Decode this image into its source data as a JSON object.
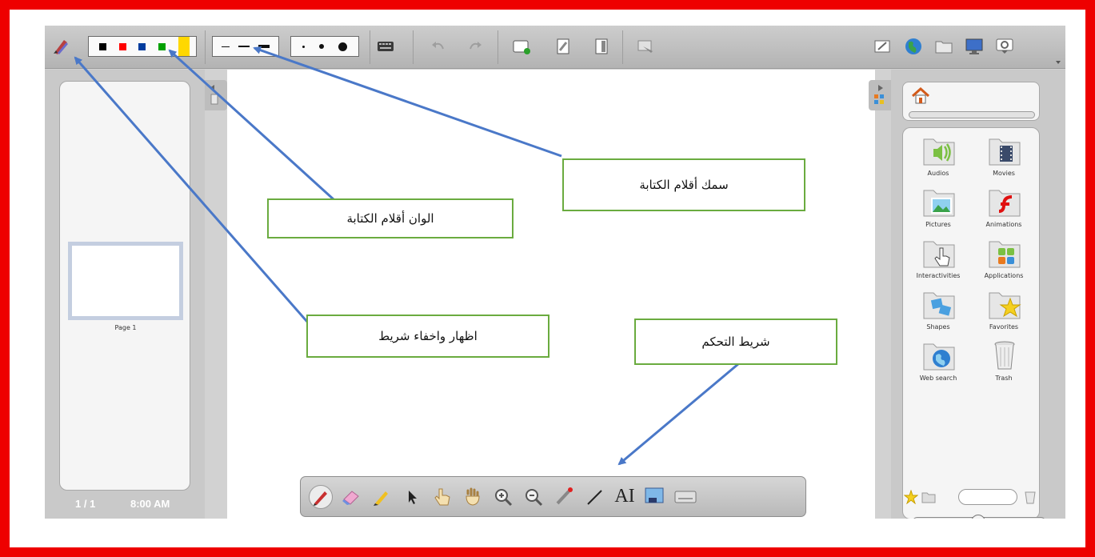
{
  "colors": {
    "frame": "#ee0000",
    "callout_border": "#6aab3f",
    "arrow": "#4a78c8",
    "pen_swatches": [
      "#000000",
      "#ff0000",
      "#003c9e",
      "#00a000",
      "#ffd800"
    ]
  },
  "toolbar": {
    "icons": [
      "pen-toggle-icon",
      "keyboard-icon",
      "undo-icon",
      "redo-icon",
      "new-page-icon",
      "page-prev-icon",
      "page-next-icon",
      "screen-capture-icon",
      "eraser-board-icon",
      "globe-icon",
      "folder-icon",
      "monitor-icon",
      "settings-icon"
    ]
  },
  "left_panel": {
    "page_thumb_label": "Page 1",
    "page_count": "1 / 1",
    "clock": "8:00 AM"
  },
  "library": {
    "items": [
      {
        "label": "Audios",
        "icon": "audio-folder-icon"
      },
      {
        "label": "Movies",
        "icon": "movie-folder-icon"
      },
      {
        "label": "Pictures",
        "icon": "pictures-folder-icon"
      },
      {
        "label": "Animations",
        "icon": "flash-folder-icon"
      },
      {
        "label": "Interactivities",
        "icon": "interactive-folder-icon"
      },
      {
        "label": "Applications",
        "icon": "apps-folder-icon"
      },
      {
        "label": "Shapes",
        "icon": "shapes-folder-icon"
      },
      {
        "label": "Favorites",
        "icon": "favorites-folder-icon"
      },
      {
        "label": "Web search",
        "icon": "web-search-icon"
      },
      {
        "label": "Trash",
        "icon": "trash-icon"
      }
    ]
  },
  "controlbar": {
    "tools": [
      "pen-tool-icon",
      "eraser-tool-icon",
      "highlighter-tool-icon",
      "pointer-tool-icon",
      "hand-pointer-tool-icon",
      "pan-hand-tool-icon",
      "zoom-in-tool-icon",
      "zoom-out-tool-icon",
      "laser-pointer-tool-icon",
      "line-tool-icon",
      "text-tool-icon",
      "capture-tool-icon",
      "virtual-keyboard-tool-icon"
    ],
    "text_tool_glyph": "AI"
  },
  "callouts": {
    "pen_thickness": "سمك أقلام الكتابة",
    "pen_colors": "الوان أقلام الكتابة",
    "show_hide_bar": "اظهار واخفاء شريط",
    "control_bar": "شريط التحكم"
  }
}
